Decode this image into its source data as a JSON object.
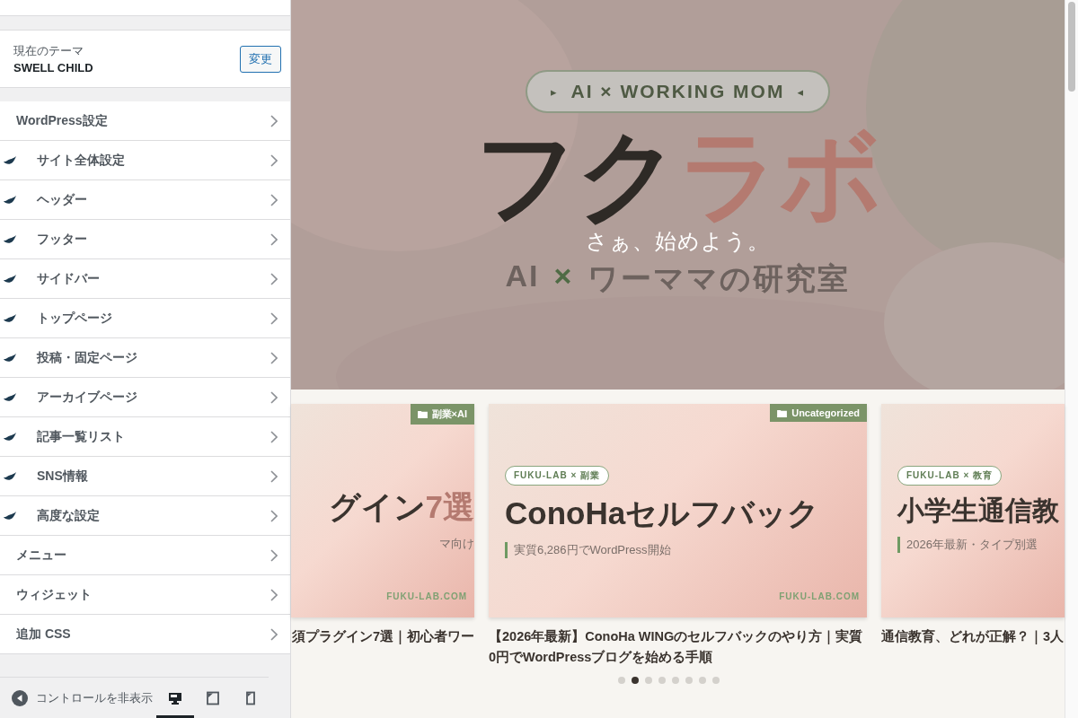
{
  "theme": {
    "label": "現在のテーマ",
    "name": "SWELL CHILD",
    "button": "変更"
  },
  "menu": [
    {
      "label": "WordPress設定",
      "kind": "plain"
    },
    {
      "label": "サイト全体設定",
      "kind": "swell"
    },
    {
      "label": "ヘッダー",
      "kind": "swell"
    },
    {
      "label": "フッター",
      "kind": "swell"
    },
    {
      "label": "サイドバー",
      "kind": "swell"
    },
    {
      "label": "トップページ",
      "kind": "swell"
    },
    {
      "label": "投稿・固定ページ",
      "kind": "swell"
    },
    {
      "label": "アーカイブページ",
      "kind": "swell"
    },
    {
      "label": "記事一覧リスト",
      "kind": "swell"
    },
    {
      "label": "SNS情報",
      "kind": "swell"
    },
    {
      "label": "高度な設定",
      "kind": "swell"
    },
    {
      "label": "メニュー",
      "kind": "plain"
    },
    {
      "label": "ウィジェット",
      "kind": "plain"
    },
    {
      "label": "追加 CSS",
      "kind": "plain"
    }
  ],
  "footer": {
    "collapse_label": "コントロールを非表示",
    "devices": [
      {
        "kind": "desktop",
        "selected": true
      },
      {
        "kind": "tablet",
        "selected": false
      },
      {
        "kind": "mobile",
        "selected": false
      }
    ]
  },
  "hero": {
    "badge": {
      "lead": "▸",
      "text": "AI × WORKING MOM",
      "trail": "◂"
    },
    "logo": {
      "main": "フク",
      "accent": "ラボ"
    },
    "overlay": "さぁ、始めよう。",
    "tagline": {
      "lead": "AI",
      "mark": "×",
      "rest": "ワーママの研究室"
    }
  },
  "posts": [
    {
      "kind": "partial-left",
      "category": "副業×AI",
      "headline": "グイン",
      "headline_accent": "7選",
      "subtitle": "マ向け",
      "site": "FUKU-LAB.COM",
      "title": "須プラグイン7選｜初心者ワー"
    },
    {
      "kind": "full",
      "category": "Uncategorized",
      "pill": "FUKU-LAB × 副業",
      "headline": "ConoHaセルフバック",
      "subtitle": "実質6,286円でWordPress開始",
      "site": "FUKU-LAB.COM",
      "title": "【2026年最新】ConoHa WINGのセルフバックのやり方｜実質0円でWordPressブログを始める手順"
    },
    {
      "kind": "partial-right",
      "pill": "FUKU-LAB × 教育",
      "headline": "小学生通信教",
      "subtitle": "2026年最新・タイプ別選",
      "title": "通信教育、どれが正解？｜3人"
    }
  ],
  "pager": [
    {
      "selected": false
    },
    {
      "selected": true
    },
    {
      "selected": false
    },
    {
      "selected": false
    },
    {
      "selected": false
    },
    {
      "selected": false
    },
    {
      "selected": false
    },
    {
      "selected": false
    }
  ]
}
